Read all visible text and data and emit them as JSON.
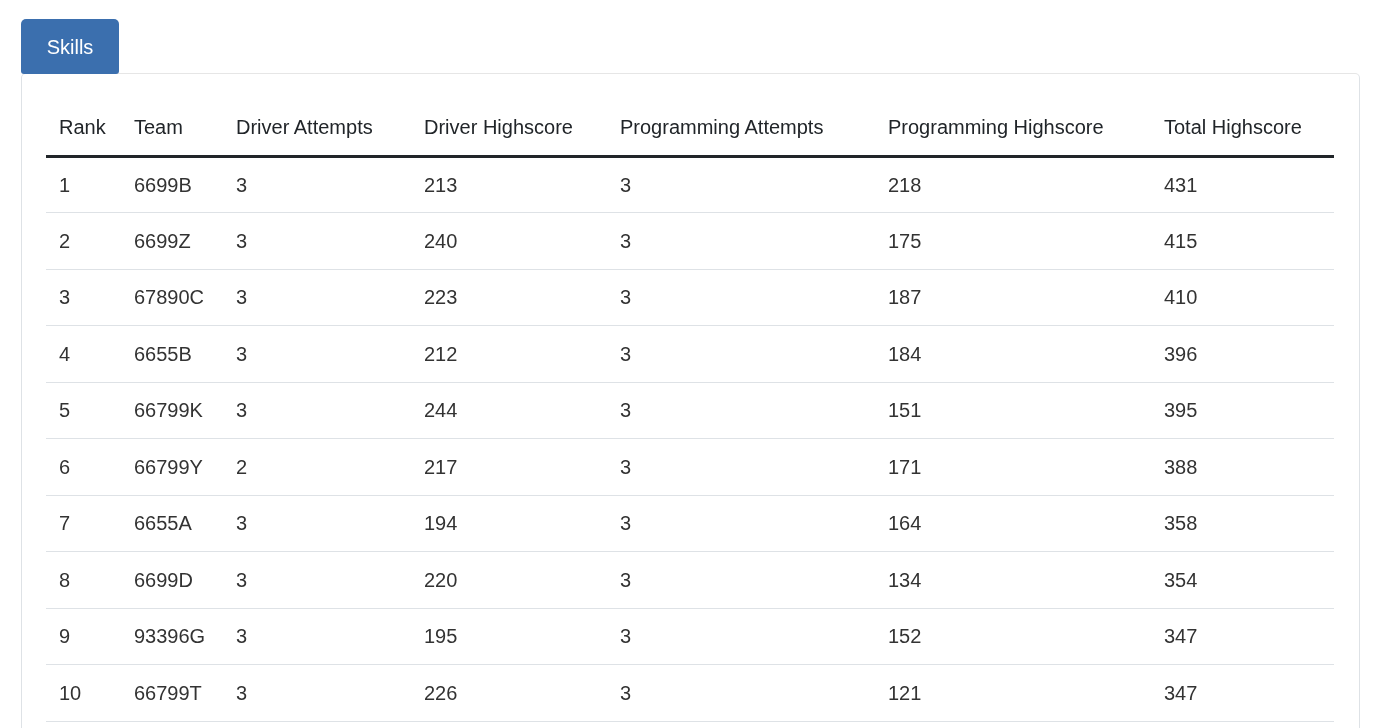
{
  "tab": {
    "label": "Skills",
    "selected": true
  },
  "table": {
    "columns": [
      "Rank",
      "Team",
      "Driver Attempts",
      "Driver Highscore",
      "Programming Attempts",
      "Programming Highscore",
      "Total Highscore"
    ],
    "rows": [
      [
        "1",
        "6699B",
        "3",
        "213",
        "3",
        "218",
        "431"
      ],
      [
        "2",
        "6699Z",
        "3",
        "240",
        "3",
        "175",
        "415"
      ],
      [
        "3",
        "67890C",
        "3",
        "223",
        "3",
        "187",
        "410"
      ],
      [
        "4",
        "6655B",
        "3",
        "212",
        "3",
        "184",
        "396"
      ],
      [
        "5",
        "66799K",
        "3",
        "244",
        "3",
        "151",
        "395"
      ],
      [
        "6",
        "66799Y",
        "2",
        "217",
        "3",
        "171",
        "388"
      ],
      [
        "7",
        "6655A",
        "3",
        "194",
        "3",
        "164",
        "358"
      ],
      [
        "8",
        "6699D",
        "3",
        "220",
        "3",
        "134",
        "354"
      ],
      [
        "9",
        "93396G",
        "3",
        "195",
        "3",
        "152",
        "347"
      ],
      [
        "10",
        "66799T",
        "3",
        "226",
        "3",
        "121",
        "347"
      ]
    ]
  }
}
